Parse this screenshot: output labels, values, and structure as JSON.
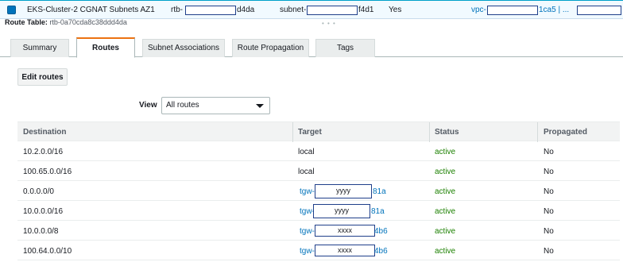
{
  "selected_row": {
    "name": "EKS-Cluster-2 CGNAT Subnets AZ1",
    "rtb_prefix": "rtb-",
    "rtb_suffix": "d4da",
    "subnet_prefix": "subnet-",
    "subnet_suffix": "f4d1",
    "main": "Yes",
    "vpc_prefix": "vpc-",
    "vpc_suffix": "1ca5 | ..."
  },
  "route_table_label": {
    "label": "Route Table:",
    "value": "rtb-0a70cda8c38ddd4da"
  },
  "tabs": [
    {
      "label": "Summary"
    },
    {
      "label": "Routes"
    },
    {
      "label": "Subnet Associations"
    },
    {
      "label": "Route Propagation"
    },
    {
      "label": "Tags"
    }
  ],
  "toolbar": {
    "edit_routes_label": "Edit routes"
  },
  "view": {
    "label": "View",
    "selected": "All routes"
  },
  "table": {
    "headers": [
      "Destination",
      "Target",
      "Status",
      "Propagated"
    ],
    "rows": [
      {
        "destination": "10.2.0.0/16",
        "target": "local",
        "status": "active",
        "propagated": "No"
      },
      {
        "destination": "100.65.0.0/16",
        "target": "local",
        "status": "active",
        "propagated": "No"
      },
      {
        "destination": "0.0.0.0/0",
        "target_prefix": "tgw-",
        "target_mask": "yyyy",
        "target_suffix": "81a",
        "status": "active",
        "propagated": "No"
      },
      {
        "destination": "10.0.0.0/16",
        "target_prefix": "tgw-",
        "target_mask": "yyyy",
        "target_suffix": "81a",
        "status": "active",
        "propagated": "No"
      },
      {
        "destination": "10.0.0.0/8",
        "target_prefix": "tgw-",
        "target_mask": "xxxx",
        "target_suffix": "4b6",
        "status": "active",
        "propagated": "No"
      },
      {
        "destination": "100.64.0.0/10",
        "target_prefix": "tgw-",
        "target_mask": "xxxx",
        "target_suffix": "4b6",
        "status": "active",
        "propagated": "No"
      }
    ]
  },
  "colors": {
    "accent_tab": "#ec7211",
    "link": "#0073bb",
    "status_active": "#1d8102",
    "redaction_border": "#1f3f8a"
  }
}
